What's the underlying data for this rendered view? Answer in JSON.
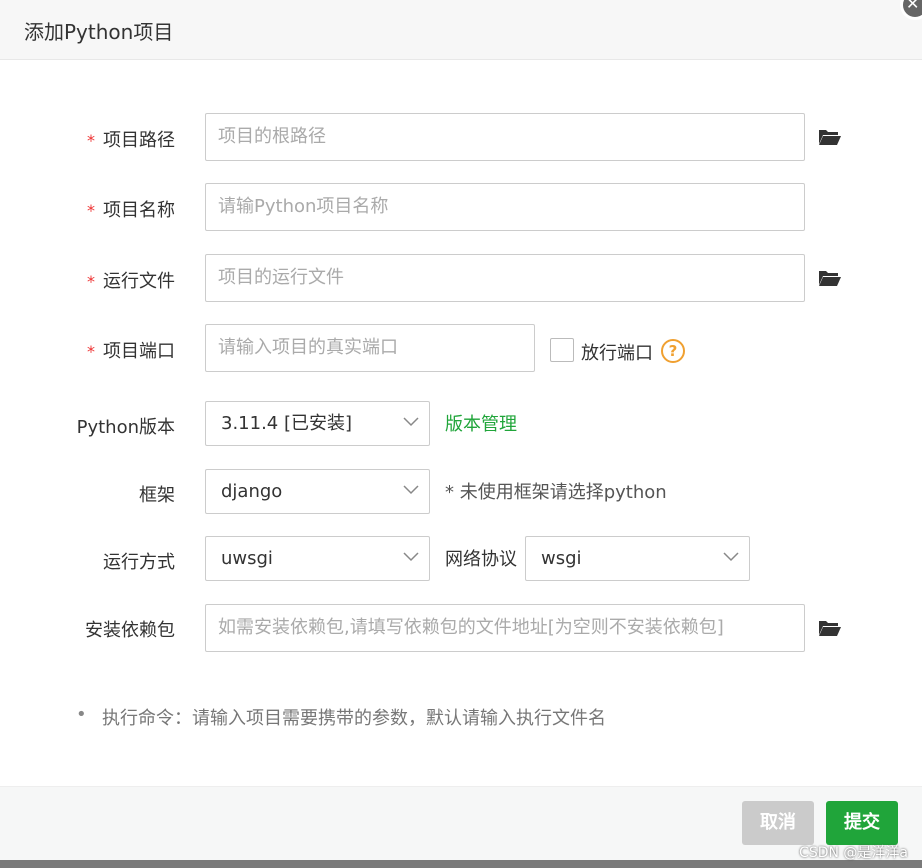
{
  "dialog": {
    "title": "添加Python项目",
    "close_glyph": "✕"
  },
  "form": {
    "project_path": {
      "label": "项目路径",
      "required_mark": "*",
      "placeholder": "项目的根路径"
    },
    "project_name": {
      "label": "项目名称",
      "required_mark": "*",
      "placeholder": "请输Python项目名称"
    },
    "run_file": {
      "label": "运行文件",
      "required_mark": "*",
      "placeholder": "项目的运行文件"
    },
    "project_port": {
      "label": "项目端口",
      "required_mark": "*",
      "placeholder": "请输入项目的真实端口",
      "open_port_label": "放行端口",
      "help_glyph": "?"
    },
    "python_version": {
      "label": "Python版本",
      "value": "3.11.4 [已安装]",
      "manage_link": "版本管理"
    },
    "framework": {
      "label": "框架",
      "value": "django",
      "hint": "* 未使用框架请选择python"
    },
    "run_mode": {
      "label": "运行方式",
      "value": "uwsgi",
      "protocol_label": "网络协议",
      "protocol_value": "wsgi"
    },
    "dependencies": {
      "label": "安装依赖包",
      "placeholder": "如需安装依赖包,请填写依赖包的文件地址[为空则不安装依赖包]"
    }
  },
  "tips": {
    "bullet": "•",
    "command_tip": "执行命令：请输入项目需要携带的参数，默认请输入执行文件名"
  },
  "footer": {
    "cancel_label": "取消",
    "submit_label": "提交"
  },
  "watermark": "CSDN @是洋洋a",
  "colors": {
    "accent": "#20a53a",
    "required": "#e33333",
    "help": "#f0a030"
  },
  "icons": [
    "folder-open-icon",
    "chevron-down-icon",
    "question-icon",
    "close-icon"
  ]
}
